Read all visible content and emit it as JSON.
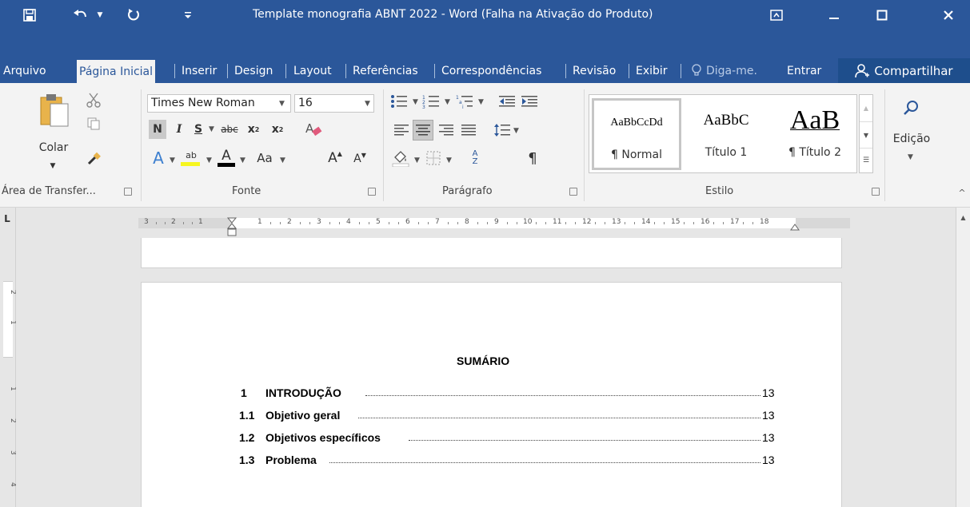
{
  "titlebar": {
    "title": "Template monografia ABNT 2022 - Word (Falha na Ativação do Produto)",
    "qa_icons": [
      "save-icon",
      "undo-icon",
      "redo-icon",
      "customize-icon"
    ],
    "window_icons": [
      "ribbon-display-icon",
      "minimize-icon",
      "maximize-icon",
      "close-icon"
    ]
  },
  "tabs": {
    "items": [
      "Arquivo",
      "Página Inicial",
      "Inserir",
      "Design",
      "Layout",
      "Referências",
      "Correspondências",
      "Revisão",
      "Exibir"
    ],
    "active": "Página Inicial",
    "tellme": "Diga-me.",
    "signin": "Entrar",
    "share": "Compartilhar"
  },
  "ribbon": {
    "clipboard": {
      "paste_label": "Colar",
      "group_label": "Área de Transfer..."
    },
    "font": {
      "font_name": "Times New Roman",
      "font_size": "16",
      "group_label": "Fonte",
      "bold": "N",
      "italic": "I",
      "underline": "S",
      "strike": "abc",
      "subscript": "x",
      "subscript_index": "2",
      "superscript": "x",
      "superscript_index": "2",
      "grow": "A",
      "shrink": "A",
      "changecase": "Aa",
      "fontcolor": "A",
      "highlight_text": "ab",
      "effects": "A"
    },
    "paragraph": {
      "group_label": "Parágrafo",
      "show_marks": "¶",
      "sort_top": "A",
      "sort_bottom": "Z"
    },
    "styles": {
      "group_label": "Estilo",
      "items": [
        {
          "preview": "AaBbCcDd",
          "name": "¶ Normal"
        },
        {
          "preview": "AaBbC",
          "name": "Título 1"
        },
        {
          "preview": "AaB",
          "name": "¶ Título 2"
        }
      ]
    },
    "editing": {
      "label": "Edição"
    }
  },
  "ruler": {
    "marks": [
      "3",
      "2",
      "1",
      "1",
      "2",
      "3",
      "4",
      "5",
      "6",
      "7",
      "8",
      "9",
      "10",
      "11",
      "12",
      "13",
      "14",
      "15",
      "16",
      "17",
      "18"
    ],
    "vertical_marks": [
      "2",
      "1",
      "1",
      "2",
      "3",
      "4"
    ],
    "corner": "L"
  },
  "document": {
    "heading": "SUMÁRIO",
    "toc": [
      {
        "num": "1",
        "title": "INTRODUÇÃO",
        "page": "13"
      },
      {
        "num": "1.1",
        "title": "Objetivo geral",
        "page": "13"
      },
      {
        "num": "1.2",
        "title": "Objetivos específicos",
        "page": "13"
      },
      {
        "num": "1.3",
        "title": "Problema",
        "page": "13"
      }
    ]
  },
  "colors": {
    "accent": "#2b579a",
    "share_bg": "#1e4e8c",
    "ribbon_bg": "#f3f3f3",
    "canvas_bg": "#e6e6e6"
  }
}
